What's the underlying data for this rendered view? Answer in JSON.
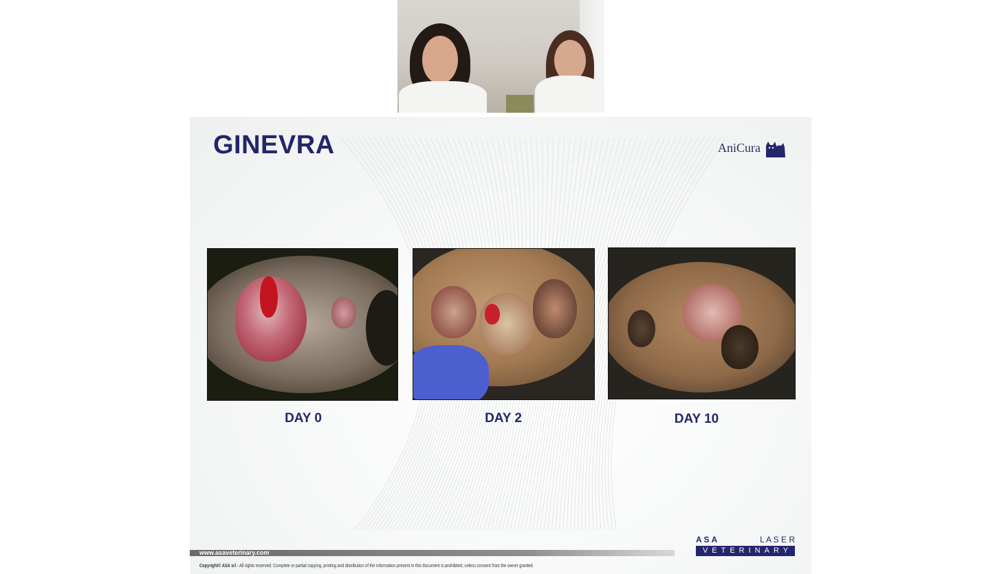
{
  "slide": {
    "title": "GINEVRA",
    "logo_text": "AniCura",
    "photos": [
      {
        "caption": "DAY 0"
      },
      {
        "caption": "DAY 2"
      },
      {
        "caption": "DAY 10"
      }
    ],
    "footer": {
      "url": "www.asaveterinary.com",
      "copyright_owner": "Copyright© ASA srl -",
      "copyright_text": "All rights reserved. Complete or partial copying, printing and distribution of the information present in this document is prohibited, unless consent from the owner granted."
    },
    "brand": {
      "asa_letters": "A S A",
      "laser_letters": "L A S E R",
      "veterinary": "VETERINARY"
    }
  },
  "colors": {
    "title": "#23266b",
    "brand_bar": "#23266b"
  },
  "icons": {
    "anicura_mark": "cat-dog-silhouette-icon"
  }
}
